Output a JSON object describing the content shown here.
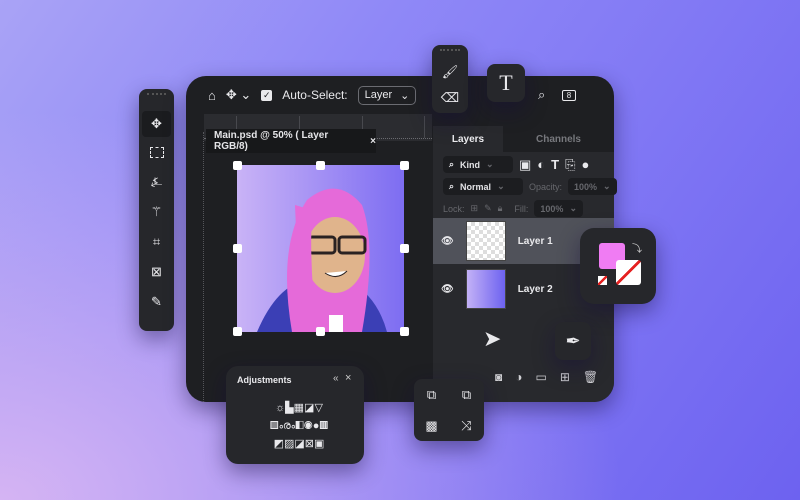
{
  "toolbar": {
    "auto_select_label": "Auto-Select:",
    "auto_select_checked": true,
    "layer_select": "Layer",
    "icons": [
      "home-icon",
      "move-icon",
      "search-icon",
      "workspace-icon"
    ]
  },
  "document": {
    "tab_title": "Main.psd @ 50% ( Layer RGB/8)",
    "close_label": "×"
  },
  "layers_panel": {
    "tabs": [
      {
        "label": "Layers",
        "active": true
      },
      {
        "label": "Channels",
        "active": false
      }
    ],
    "filter": {
      "label": "Kind"
    },
    "blend": {
      "label": "Normal"
    },
    "opacity": {
      "label": "Opacity:",
      "value": "100%"
    },
    "lock": {
      "label": "Lock:"
    },
    "fill": {
      "label": "Fill:",
      "value": "100%"
    },
    "layers": [
      {
        "name": "Layer 1",
        "selected": true,
        "visible": true
      },
      {
        "name": "Layer 2",
        "selected": false,
        "visible": true
      }
    ]
  },
  "adjustments": {
    "title": "Adjustments",
    "collapse": "«",
    "close": "×"
  },
  "colors": {
    "foreground": "#f07cf3",
    "accent": "#6d62f0"
  }
}
